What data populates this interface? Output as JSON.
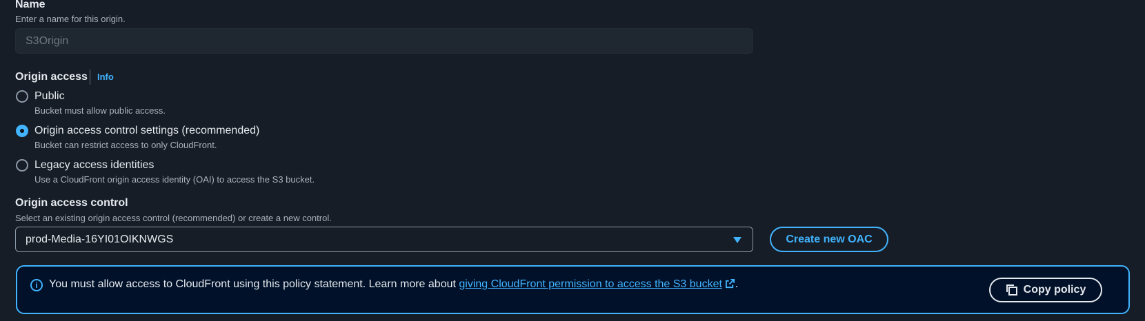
{
  "name_field": {
    "label": "Name",
    "description": "Enter a name for this origin.",
    "value": "S3Origin"
  },
  "origin_access": {
    "label": "Origin access",
    "info_link": "Info",
    "options": [
      {
        "title": "Public",
        "description": "Bucket must allow public access.",
        "selected": false
      },
      {
        "title": "Origin access control settings (recommended)",
        "description": "Bucket can restrict access to only CloudFront.",
        "selected": true
      },
      {
        "title": "Legacy access identities",
        "description": "Use a CloudFront origin access identity (OAI) to access the S3 bucket.",
        "selected": false
      }
    ]
  },
  "oac": {
    "label": "Origin access control",
    "description": "Select an existing origin access control (recommended) or create a new control.",
    "selected_value": "prod-Media-16YI01OIKNWGS",
    "create_button": "Create new OAC"
  },
  "alert": {
    "text_prefix": "You must allow access to CloudFront using this policy statement. Learn more about ",
    "link_text": "giving CloudFront permission to access the S3 bucket",
    "text_suffix": ".",
    "copy_button": "Copy policy"
  },
  "colors": {
    "background": "#161d26",
    "accent": "#42b4ff",
    "alert_background": "#001129"
  },
  "icons": [
    "info-icon",
    "external-link-icon",
    "copy-icon",
    "caret-down-icon"
  ]
}
